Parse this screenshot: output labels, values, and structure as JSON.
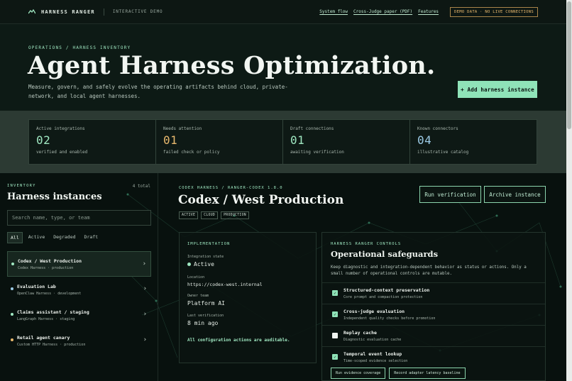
{
  "nav": {
    "brand": "HARNESS RANGER",
    "subtitle": "INTERACTIVE DEMO",
    "links": [
      "System flow",
      "Cross-Judge paper (PDF)",
      "Features"
    ],
    "badge": "DEMO DATA · NO LIVE CONNECTIONS"
  },
  "hero": {
    "eyebrow": "OPERATIONS / HARNESS INVENTORY",
    "title": "Agent Harness Optimization.",
    "description": "Measure, govern, and safely evolve the operating artifacts behind cloud, private-network, and local agent harnesses.",
    "add_button": "+ Add harness instance"
  },
  "stats": [
    {
      "label": "Active integrations",
      "value": "02",
      "note": "verified and enabled"
    },
    {
      "label": "Needs attention",
      "value": "01",
      "note": "failed check or policy"
    },
    {
      "label": "Draft connections",
      "value": "01",
      "note": "awaiting verification"
    },
    {
      "label": "Known connectors",
      "value": "04",
      "note": "illustrative catalog"
    }
  ],
  "inventory": {
    "eyebrow": "INVENTORY",
    "total": "4 total",
    "title": "Harness instances",
    "search_placeholder": "Search name, type, or team",
    "filters": [
      "All",
      "Active",
      "Degraded",
      "Draft"
    ],
    "instances": [
      {
        "name": "Codex / West Production",
        "meta": "Codex Harness · production",
        "status_color": "#9fe7c1"
      },
      {
        "name": "Evaluation Lab",
        "meta": "OpenClaw Harness · development",
        "status_color": "#9ccbe6"
      },
      {
        "name": "Claims assistant / staging",
        "meta": "LangGraph Harness · staging",
        "status_color": "#9fe7c1"
      },
      {
        "name": "Retail agent canary",
        "meta": "Custom HTTP Harness · production",
        "status_color": "#e9b96e"
      }
    ]
  },
  "detail": {
    "crumb": "CODEX HARNESS / RANGER-CODEX 1.8.0",
    "title": "Codex / West Production",
    "tags": [
      "ACTIVE",
      "CLOUD",
      "PRODUCTION"
    ],
    "run_button": "Run verification",
    "archive_button": "Archive instance",
    "implementation": {
      "eyebrow": "IMPLEMENTATION",
      "status_label": "Integration state",
      "status_value": "Active",
      "location_label": "Location",
      "location_value": "https://codex-west.internal",
      "owner_label": "Owner team",
      "owner_value": "Platform AI",
      "verification_label": "Last verification",
      "verification_value": "8 min ago",
      "note": "All configuration actions are auditable."
    },
    "controls": {
      "eyebrow": "HARNESS RANGER CONTROLS",
      "title": "Operational safeguards",
      "description": "Keep diagnostic and integration-dependent behavior as status or actions. Only a small number of operational controls are mutable.",
      "items": [
        {
          "name": "Structured-context preservation",
          "sub": "Core prompt and compaction protection",
          "checked": true
        },
        {
          "name": "Cross-judge evaluation",
          "sub": "Independent quality checks before promotion",
          "checked": true
        },
        {
          "name": "Replay cache",
          "sub": "Diagnostic evaluation cache",
          "checked": false
        },
        {
          "name": "Temporal event lookup",
          "sub": "Time-scoped evidence selection",
          "checked": true
        }
      ],
      "buttons": [
        "Run evidence coverage",
        "Record adapter latency baseline"
      ]
    }
  }
}
